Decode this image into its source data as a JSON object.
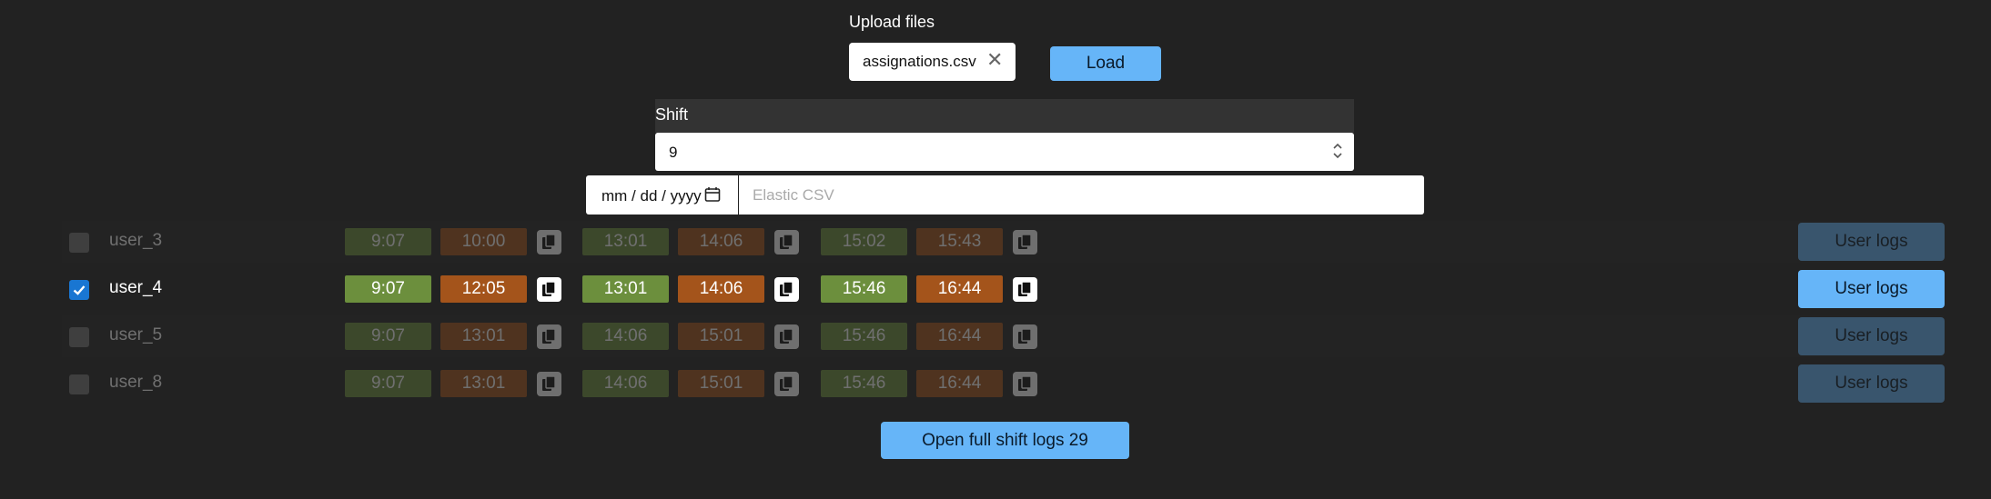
{
  "upload": {
    "label": "Upload files",
    "file_name": "assignations.csv",
    "load_label": "Load"
  },
  "shift": {
    "label": "Shift",
    "value": "9"
  },
  "date": {
    "value": "mm / dd / yyyy"
  },
  "elastic": {
    "placeholder": "Elastic CSV"
  },
  "rows": [
    {
      "user": "user_3",
      "checked": false,
      "times": [
        "9:07",
        "10:00",
        "13:01",
        "14:06",
        "15:02",
        "15:43"
      ],
      "logs_label": "User logs"
    },
    {
      "user": "user_4",
      "checked": true,
      "times": [
        "9:07",
        "12:05",
        "13:01",
        "14:06",
        "15:46",
        "16:44"
      ],
      "logs_label": "User logs"
    },
    {
      "user": "user_5",
      "checked": false,
      "times": [
        "9:07",
        "13:01",
        "14:06",
        "15:01",
        "15:46",
        "16:44"
      ],
      "logs_label": "User logs"
    },
    {
      "user": "user_8",
      "checked": false,
      "times": [
        "9:07",
        "13:01",
        "14:06",
        "15:01",
        "15:46",
        "16:44"
      ],
      "logs_label": "User logs"
    }
  ],
  "footer": {
    "open_full_label": "Open full shift logs 29"
  },
  "colors": {
    "accent": "#66b5f8",
    "start": "#6c8f3d",
    "end": "#a4541b",
    "checkbox": "#1976d2",
    "background": "#222222"
  },
  "icons": [
    "close-icon",
    "select-arrows-icon",
    "calendar-icon",
    "copy-icon",
    "check-icon"
  ]
}
